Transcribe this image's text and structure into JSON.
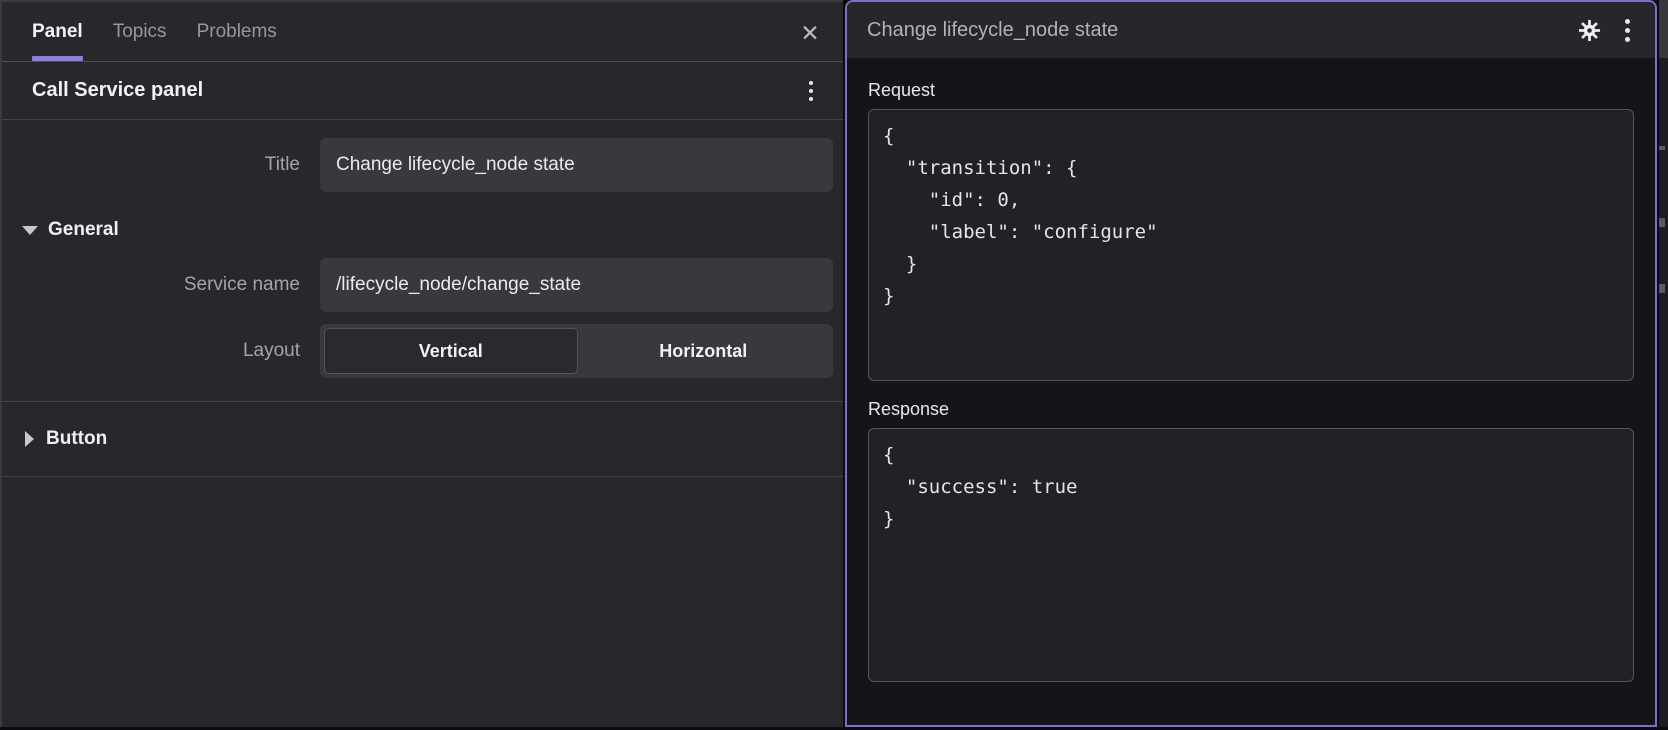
{
  "left_panel": {
    "tabs": [
      {
        "label": "Panel",
        "active": true
      },
      {
        "label": "Topics",
        "active": false
      },
      {
        "label": "Problems",
        "active": false
      }
    ],
    "close_icon_glyph": "✕",
    "section_title": "Call Service panel",
    "fields": {
      "title": {
        "label": "Title",
        "value": "Change lifecycle_node state"
      },
      "service_name": {
        "label": "Service name",
        "value": "/lifecycle_node/change_state"
      },
      "layout": {
        "label": "Layout",
        "selected": "Vertical",
        "options": [
          {
            "label": "Vertical",
            "selected": true
          },
          {
            "label": "Horizontal",
            "selected": false
          }
        ]
      }
    },
    "sections": {
      "general": {
        "label": "General",
        "expanded": true
      },
      "button": {
        "label": "Button",
        "expanded": false
      }
    }
  },
  "right_panel": {
    "title": "Change lifecycle_node state",
    "request": {
      "label": "Request",
      "code": "{\n  \"transition\": {\n    \"id\": 0,\n    \"label\": \"configure\"\n  }\n}"
    },
    "response": {
      "label": "Response",
      "code": "{\n  \"success\": true\n}"
    }
  },
  "colors": {
    "accent_purple": "#8b80d6",
    "panel_selection_border": "#7d71c6",
    "sidebar_bg": "#29272c",
    "panel_bg": "#161419",
    "input_bg": "#3a383e",
    "code_box_bg": "#232127",
    "muted_text": "#a5a3ab"
  }
}
